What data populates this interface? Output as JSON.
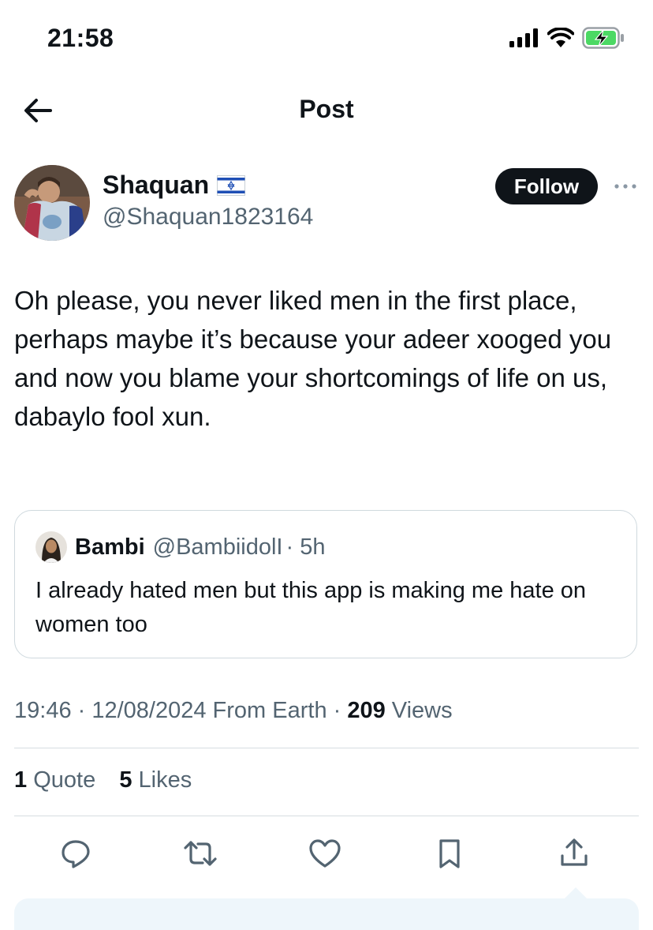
{
  "status_bar": {
    "time": "21:58"
  },
  "header": {
    "title": "Post"
  },
  "author": {
    "name": "Shaquan",
    "handle": "@Shaquan1823164",
    "follow_label": "Follow"
  },
  "post": {
    "text": "Oh please, you never liked men in the first place, perhaps maybe it’s because your adeer xooged you and now you blame your shortcomings of life on us,\ndabaylo fool xun."
  },
  "quote": {
    "name": "Bambi",
    "handle": "@BambiidolI",
    "time": "· 5h",
    "text": "I already hated men but this app is making me hate on women too"
  },
  "meta": {
    "datetime": "19:46 · 12/08/2024 From Earth · ",
    "views_count": "209",
    "views_label": " Views"
  },
  "stats": {
    "quotes_count": "1",
    "quotes_label": " Quote",
    "likes_count": "5",
    "likes_label": " Likes"
  },
  "icons": {
    "back": "arrow-left-icon",
    "reply": "reply-icon",
    "repost": "repost-icon",
    "like": "heart-icon",
    "bookmark": "bookmark-icon",
    "share": "share-icon",
    "more": "more-icon",
    "flag": "israel-flag-icon"
  },
  "colors": {
    "text": "#0f1419",
    "secondary": "#536471",
    "border": "#cfd9de",
    "follow_bg": "#0f1419"
  }
}
